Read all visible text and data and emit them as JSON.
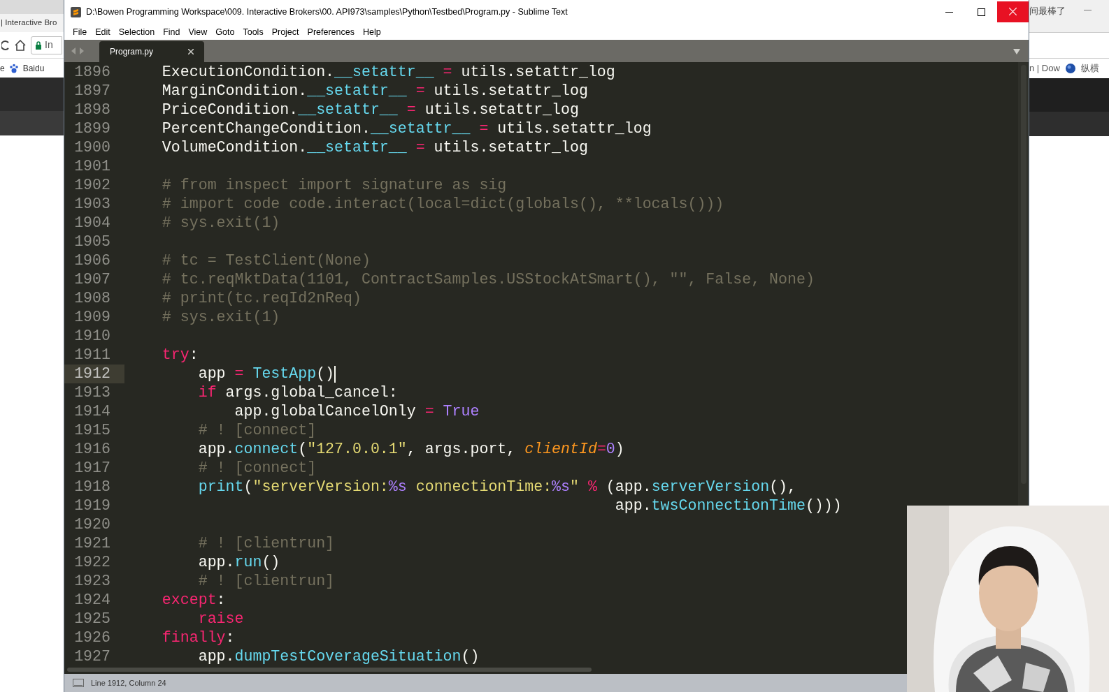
{
  "background_left": {
    "tab_title": "| Interactive Bro",
    "address": "In",
    "bookmarks": [
      "e",
      "Baidu"
    ]
  },
  "background_right": {
    "title": "间最棒了",
    "bookmarks": [
      "n | Dow",
      "纵横"
    ]
  },
  "window": {
    "title": "D:\\Bowen Programming Workspace\\009. Interactive Brokers\\00. API973\\samples\\Python\\Testbed\\Program.py - Sublime Text",
    "menu": [
      "File",
      "Edit",
      "Selection",
      "Find",
      "View",
      "Goto",
      "Tools",
      "Project",
      "Preferences",
      "Help"
    ],
    "tabs": [
      {
        "label": "Program.py",
        "selected": true
      }
    ],
    "lines": [
      {
        "number": "1896",
        "current": false,
        "tokens": [
          {
            "kind": "plain",
            "text": "    ExecutionCondition."
          },
          {
            "kind": "call",
            "text": "__setattr__"
          },
          {
            "kind": "keyword",
            "text": " = "
          },
          {
            "kind": "plain",
            "text": "utils.setattr_log"
          }
        ]
      },
      {
        "number": "1897",
        "current": false,
        "tokens": [
          {
            "kind": "plain",
            "text": "    MarginCondition."
          },
          {
            "kind": "call",
            "text": "__setattr__"
          },
          {
            "kind": "keyword",
            "text": " = "
          },
          {
            "kind": "plain",
            "text": "utils.setattr_log"
          }
        ]
      },
      {
        "number": "1898",
        "current": false,
        "tokens": [
          {
            "kind": "plain",
            "text": "    PriceCondition."
          },
          {
            "kind": "call",
            "text": "__setattr__"
          },
          {
            "kind": "keyword",
            "text": " = "
          },
          {
            "kind": "plain",
            "text": "utils.setattr_log"
          }
        ]
      },
      {
        "number": "1899",
        "current": false,
        "tokens": [
          {
            "kind": "plain",
            "text": "    PercentChangeCondition."
          },
          {
            "kind": "call",
            "text": "__setattr__"
          },
          {
            "kind": "keyword",
            "text": " = "
          },
          {
            "kind": "plain",
            "text": "utils.setattr_log"
          }
        ]
      },
      {
        "number": "1900",
        "current": false,
        "tokens": [
          {
            "kind": "plain",
            "text": "    VolumeCondition."
          },
          {
            "kind": "call",
            "text": "__setattr__"
          },
          {
            "kind": "keyword",
            "text": " = "
          },
          {
            "kind": "plain",
            "text": "utils.setattr_log"
          }
        ]
      },
      {
        "number": "1901",
        "current": false
      },
      {
        "number": "1902",
        "current": false,
        "tokens": [
          {
            "kind": "comment",
            "text": "    # from inspect import signature as sig"
          }
        ]
      },
      {
        "number": "1903",
        "current": false,
        "tokens": [
          {
            "kind": "comment",
            "text": "    # import code code.interact(local=dict(globals(), **locals()))"
          }
        ]
      },
      {
        "number": "1904",
        "current": false,
        "tokens": [
          {
            "kind": "comment",
            "text": "    # sys.exit(1)"
          }
        ]
      },
      {
        "number": "1905",
        "current": false
      },
      {
        "number": "1906",
        "current": false,
        "tokens": [
          {
            "kind": "comment",
            "text": "    # tc = TestClient(None)"
          }
        ]
      },
      {
        "number": "1907",
        "current": false,
        "tokens": [
          {
            "kind": "comment",
            "text": "    # tc.reqMktData(1101, ContractSamples.USStockAtSmart(), \"\", False, None)"
          }
        ]
      },
      {
        "number": "1908",
        "current": false,
        "tokens": [
          {
            "kind": "comment",
            "text": "    # print(tc.reqId2nReq)"
          }
        ]
      },
      {
        "number": "1909",
        "current": false,
        "tokens": [
          {
            "kind": "comment",
            "text": "    # sys.exit(1)"
          }
        ]
      },
      {
        "number": "1910",
        "current": false
      },
      {
        "number": "1911",
        "current": false,
        "tokens": [
          {
            "kind": "keyword",
            "text": "    try"
          },
          {
            "kind": "plain",
            "text": ":"
          }
        ]
      },
      {
        "number": "1912",
        "current": true,
        "tokens": [
          {
            "kind": "plain",
            "text": "        app "
          },
          {
            "kind": "keyword",
            "text": "= "
          },
          {
            "kind": "call",
            "text": "TestApp"
          },
          {
            "kind": "plain",
            "text": "()"
          }
        ]
      },
      {
        "number": "1913",
        "current": false,
        "tokens": [
          {
            "kind": "keyword",
            "text": "        if"
          },
          {
            "kind": "plain",
            "text": " args.global_cancel:"
          }
        ]
      },
      {
        "number": "1914",
        "current": false,
        "tokens": [
          {
            "kind": "plain",
            "text": "            app.globalCancelOnly "
          },
          {
            "kind": "keyword",
            "text": "= "
          },
          {
            "kind": "constant",
            "text": "True"
          }
        ]
      },
      {
        "number": "1915",
        "current": false,
        "tokens": [
          {
            "kind": "comment",
            "text": "        # ! [connect]"
          }
        ]
      },
      {
        "number": "1916",
        "current": false,
        "tokens": [
          {
            "kind": "plain",
            "text": "        app."
          },
          {
            "kind": "call",
            "text": "connect"
          },
          {
            "kind": "plain",
            "text": "("
          },
          {
            "kind": "string",
            "text": "\"127.0.0.1\""
          },
          {
            "kind": "plain",
            "text": ", args.port, "
          },
          {
            "kind": "param",
            "text": "clientId"
          },
          {
            "kind": "keyword",
            "text": "="
          },
          {
            "kind": "constant",
            "text": "0"
          },
          {
            "kind": "plain",
            "text": ")"
          }
        ]
      },
      {
        "number": "1917",
        "current": false,
        "tokens": [
          {
            "kind": "comment",
            "text": "        # ! [connect]"
          }
        ]
      },
      {
        "number": "1918",
        "current": false,
        "tokens": [
          {
            "kind": "call",
            "text": "        print"
          },
          {
            "kind": "plain",
            "text": "("
          },
          {
            "kind": "string",
            "text": "\"serverVersion:"
          },
          {
            "kind": "constant",
            "text": "%s"
          },
          {
            "kind": "string",
            "text": " connectionTime:"
          },
          {
            "kind": "constant",
            "text": "%s"
          },
          {
            "kind": "string",
            "text": "\" "
          },
          {
            "kind": "keyword",
            "text": "% "
          },
          {
            "kind": "plain",
            "text": "(app."
          },
          {
            "kind": "call",
            "text": "serverVersion"
          },
          {
            "kind": "plain",
            "text": "(),"
          }
        ]
      },
      {
        "number": "1919",
        "current": false,
        "tokens": [
          {
            "kind": "plain",
            "text": "                                                      app."
          },
          {
            "kind": "call",
            "text": "twsConnectionTime"
          },
          {
            "kind": "plain",
            "text": "()))"
          }
        ]
      },
      {
        "number": "1920",
        "current": false
      },
      {
        "number": "1921",
        "current": false,
        "tokens": [
          {
            "kind": "comment",
            "text": "        # ! [clientrun]"
          }
        ]
      },
      {
        "number": "1922",
        "current": false,
        "tokens": [
          {
            "kind": "plain",
            "text": "        app."
          },
          {
            "kind": "call",
            "text": "run"
          },
          {
            "kind": "plain",
            "text": "()"
          }
        ]
      },
      {
        "number": "1923",
        "current": false,
        "tokens": [
          {
            "kind": "comment",
            "text": "        # ! [clientrun]"
          }
        ]
      },
      {
        "number": "1924",
        "current": false,
        "tokens": [
          {
            "kind": "keyword",
            "text": "    except"
          },
          {
            "kind": "plain",
            "text": ":"
          }
        ]
      },
      {
        "number": "1925",
        "current": false,
        "tokens": [
          {
            "kind": "keyword",
            "text": "        raise"
          }
        ]
      },
      {
        "number": "1926",
        "current": false,
        "tokens": [
          {
            "kind": "keyword",
            "text": "    finally"
          },
          {
            "kind": "plain",
            "text": ":"
          }
        ]
      },
      {
        "number": "1927",
        "current": false,
        "tokens": [
          {
            "kind": "plain",
            "text": "        app."
          },
          {
            "kind": "call",
            "text": "dumpTestCoverageSituation"
          },
          {
            "kind": "plain",
            "text": "()"
          }
        ]
      }
    ],
    "status": "Line 1912, Column 24"
  }
}
